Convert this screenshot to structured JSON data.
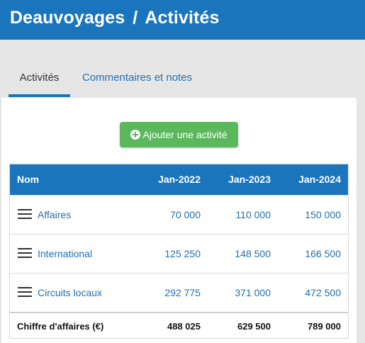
{
  "header": {
    "site": "Deauvoyages",
    "separator": "/",
    "page": "Activités"
  },
  "tabs": [
    {
      "label": "Activités",
      "active": true
    },
    {
      "label": "Commentaires et notes",
      "active": false
    }
  ],
  "add_button": {
    "label": "Ajouter une activité",
    "icon": "plus-circle-icon"
  },
  "table": {
    "columns": [
      "Nom",
      "Jan-2022",
      "Jan-2023",
      "Jan-2024"
    ],
    "rows": [
      {
        "name": "Affaires",
        "values": [
          "70 000",
          "110 000",
          "150 000"
        ]
      },
      {
        "name": "International",
        "values": [
          "125 250",
          "148 500",
          "166 500"
        ]
      },
      {
        "name": "Circuits locaux",
        "values": [
          "292 775",
          "371 000",
          "472 500"
        ]
      }
    ],
    "total": {
      "label": "Chiffre d'affaires (€)",
      "values": [
        "488 025",
        "629 500",
        "789 000"
      ]
    }
  },
  "colors": {
    "header_bg": "#1a75bd",
    "link": "#1f6fb6",
    "button_bg": "#5cb85c",
    "page_bg": "#e6e6e6"
  }
}
